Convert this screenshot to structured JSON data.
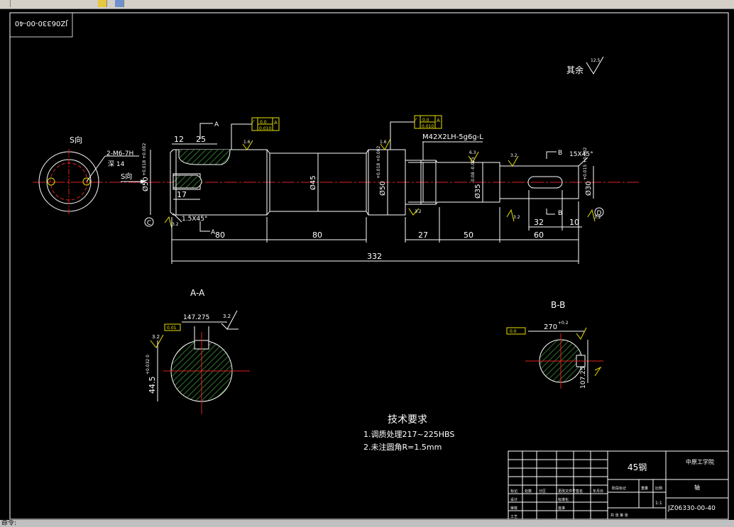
{
  "app": {
    "status_text": "命令:"
  },
  "drawing": {
    "frame_code": "JZ06330-00-40",
    "other_roughness_label": "其余",
    "other_roughness_value": "12.5",
    "view_s_label": "S向",
    "arrow_s_label": "S向",
    "thread_holes": "2-M6-7H",
    "thread_depth": "深 14",
    "section_a_mark": "A",
    "section_b_mark": "B",
    "datum_c": "C",
    "datum_d": "D",
    "tol_a_sym": "⁄",
    "tol_a_val1": "0.0",
    "tol_a_val2": "0.010",
    "tol_a_ref": "A",
    "tol_b_val1": "0.0",
    "tol_b_val2": "0.010",
    "tol_b_ref": "A",
    "thread_spec": "M42X2LH-5g6g-L",
    "rough_1_6a": "1.6",
    "rough_1_6b": "1.6",
    "rough_6_3": "6.3",
    "rough_3_2a": "3.2",
    "rough_3_2b": "3.2",
    "rough_3_2c": "3.2",
    "rough_3_2d": "3.2",
    "rough_3_2e": "3.2",
    "rough_3_2f": "3.2",
    "chamfer_left": "1.5X45°",
    "chamfer_right": "15X45°",
    "dim_12": "12",
    "dim_25": "25",
    "dim_17": "17",
    "dia_50a": "Ø50",
    "dia_50a_tol": "+0.018 +0.002",
    "dia_45": "Ø45",
    "dia_50b": "Ø50",
    "dia_50b_tol": "+0.018 +0.002",
    "dia_35": "Ø35",
    "dia_35_tol": "-0.08 -0.025",
    "dia_30": "Ø30",
    "dia_30_tol": "+0.015 +0.002",
    "len_80a": "80",
    "len_80b": "80",
    "len_27": "27",
    "len_50": "50",
    "len_60": "60",
    "len_32": "32",
    "len_10": "10",
    "len_total": "332",
    "section_aa_title": "A-A",
    "section_bb_title": "B-B",
    "aa_width": "147.275",
    "aa_rough": "3.2",
    "aa_rough2": "3.2",
    "aa_dia": "44.5",
    "aa_dia_tol": "+0.032 0",
    "aa_key_tol": "0.01",
    "bb_width": "270",
    "bb_width_tol": "+0.2",
    "bb_height": "107.25",
    "bb_key_tol": "0.0",
    "tech_title": "技术要求",
    "tech_line1": "1.调质处理217~225HBS",
    "tech_line2": "2.未注圆角R=1.5mm"
  },
  "title_block": {
    "material": "45钢",
    "company": "中原工学院",
    "part_name": "轴",
    "drawing_no": "JZ06330-00-40",
    "scale": "1:1",
    "r_mark": "标记",
    "r_count": "处数",
    "r_zone": "分区",
    "r_change": "更改文件号",
    "r_sign": "签名",
    "r_date": "年月日",
    "r_design": "设计",
    "r_std": "标准化",
    "r_stage": "阶段标记",
    "r_weight": "重量",
    "r_scale_lbl": "比例",
    "r_check": "审核",
    "r_process": "工艺",
    "r_approve": "批准",
    "r_sheet": "共 张 第 张"
  }
}
